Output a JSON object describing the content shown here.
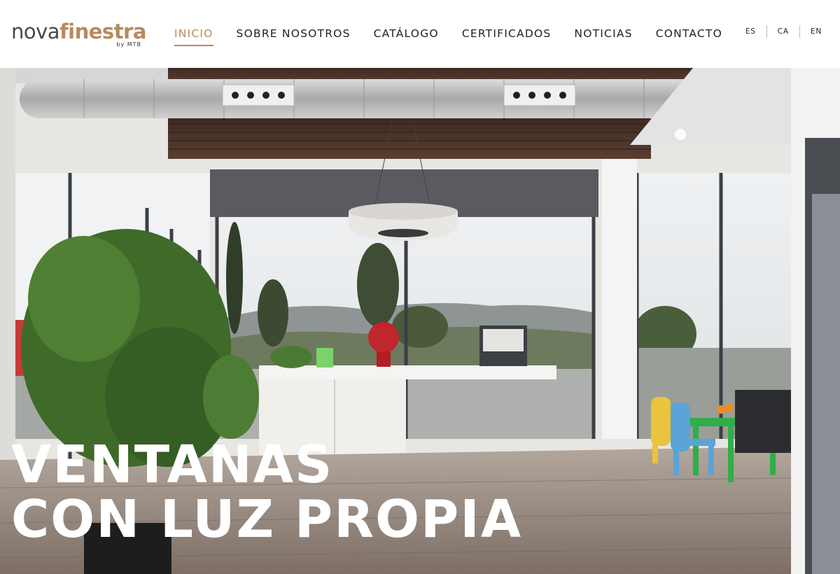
{
  "brand": {
    "logo_part1": "nova",
    "logo_part2": "finestra",
    "logo_sub": "by MTB",
    "accent_color": "#b58a5e"
  },
  "nav": {
    "items": [
      {
        "label": "INICIO",
        "active": true
      },
      {
        "label": "SOBRE NOSOTROS",
        "active": false
      },
      {
        "label": "CATÁLOGO",
        "active": false
      },
      {
        "label": "CERTIFICADOS",
        "active": false
      },
      {
        "label": "NOTICIAS",
        "active": false
      },
      {
        "label": "CONTACTO",
        "active": false
      }
    ]
  },
  "languages": [
    "ES",
    "CA",
    "EN"
  ],
  "hero": {
    "title_line1": "VENTANAS",
    "title_line2": "CON LUZ PROPIA",
    "image": "showroom-interior-photo"
  }
}
